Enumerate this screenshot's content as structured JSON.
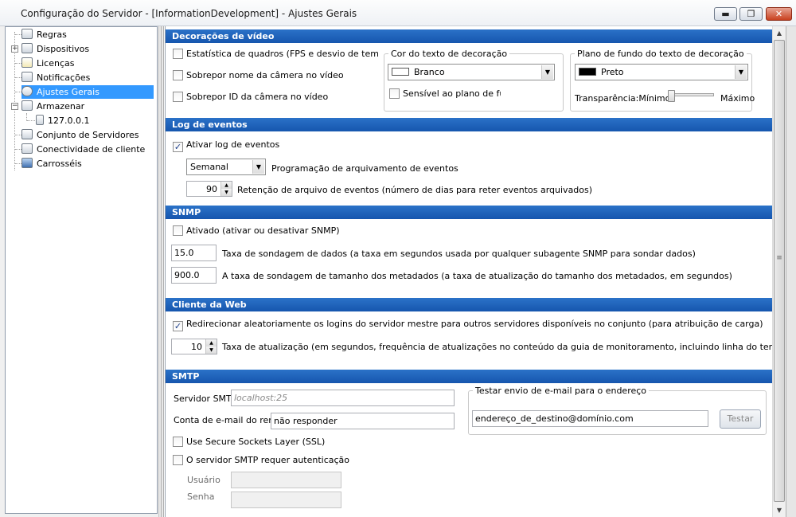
{
  "window": {
    "title": "Configuração do Servidor - [InformationDevelopment] - Ajustes Gerais",
    "controls": {
      "minimize": "▬",
      "maximize": "❐",
      "close": "✕"
    }
  },
  "tree": {
    "items": [
      {
        "label": "Regras",
        "icon": "rules-icon"
      },
      {
        "label": "Dispositivos",
        "icon": "devices-icon"
      },
      {
        "label": "Licenças",
        "icon": "licenses-icon"
      },
      {
        "label": "Notificações",
        "icon": "notifications-icon"
      },
      {
        "label": "Ajustes Gerais",
        "icon": "general-settings-icon",
        "selected": true
      },
      {
        "label": "Armazenar",
        "icon": "storage-icon"
      },
      {
        "label": "127.0.0.1",
        "icon": "server-icon"
      },
      {
        "label": "Conjunto de Servidores",
        "icon": "server-cluster-icon"
      },
      {
        "label": "Conectividade de cliente",
        "icon": "client-connectivity-icon"
      },
      {
        "label": "Carrosséis",
        "icon": "carousel-icon"
      }
    ],
    "expander_plus": "+",
    "expander_minus": "−"
  },
  "video": {
    "header": "Decorações de vídeo",
    "frame_stats": "Estatística de quadros (FPS e desvio de tempo d",
    "overlay_name": "Sobrepor nome da câmera no vídeo",
    "overlay_id": "Sobrepor ID da câmera no vídeo",
    "text_color_group": "Cor do texto de decoração",
    "text_color_value": "Branco",
    "text_color_swatch": "#ffffff",
    "sensitive_bg": "Sensível ao plano de fundo",
    "bg_group": "Plano de fundo do texto de decoração",
    "bg_value": "Preto",
    "bg_swatch": "#000000",
    "transparency_label": "Transparência:Mínimo",
    "transparency_max": "Máximo"
  },
  "events": {
    "header": "Log de eventos",
    "enable": "Ativar log de eventos",
    "enable_checked": true,
    "schedule_value": "Semanal",
    "schedule_label": "Programação de arquivamento de eventos",
    "retention_value": "90",
    "retention_label": "Retenção de arquivo de eventos (número de dias para reter eventos arquivados)"
  },
  "snmp": {
    "header": "SNMP",
    "enabled": "Ativado (ativar ou desativar SNMP)",
    "poll_value": "15.0",
    "poll_label": "Taxa de sondagem de dados (a taxa em segundos usada por qualquer subagente SNMP para sondar dados)",
    "meta_value": "900.0",
    "meta_label": "A taxa de sondagem de tamanho dos metadados (a taxa de atualização do tamanho dos metadados, em segundos)"
  },
  "web": {
    "header": "Cliente da Web",
    "redirect": "Redirecionar aleatoriamente os logins do servidor mestre para outros servidores disponíveis no conjunto (para atribuição de carga)",
    "redirect_checked": true,
    "refresh_value": "10",
    "refresh_label": "Taxa de atualização (em segundos, frequência de atualizações no conteúdo da guia de monitoramento, incluindo linha do tempo e alarmes)"
  },
  "smtp": {
    "header": "SMTP",
    "server_label": "Servidor SMTP",
    "server_placeholder": "localhost:25",
    "from_label": "Conta de e-mail do remetente",
    "from_value": "não responder",
    "ssl": "Use Secure Sockets Layer (SSL)",
    "auth": "O servidor SMTP requer autenticação",
    "user_label": "Usuário",
    "pass_label": "Senha",
    "test_group": "Testar envio de e-mail para o endereço",
    "test_address": "endereço_de_destino@domínio.com",
    "test_button": "Testar"
  },
  "icons": {
    "check": "✓",
    "combo_arrow": "▼",
    "spin_up": "▲",
    "spin_down": "▼",
    "scroll_up": "▲",
    "scroll_down": "▼",
    "splitter": "≡"
  }
}
